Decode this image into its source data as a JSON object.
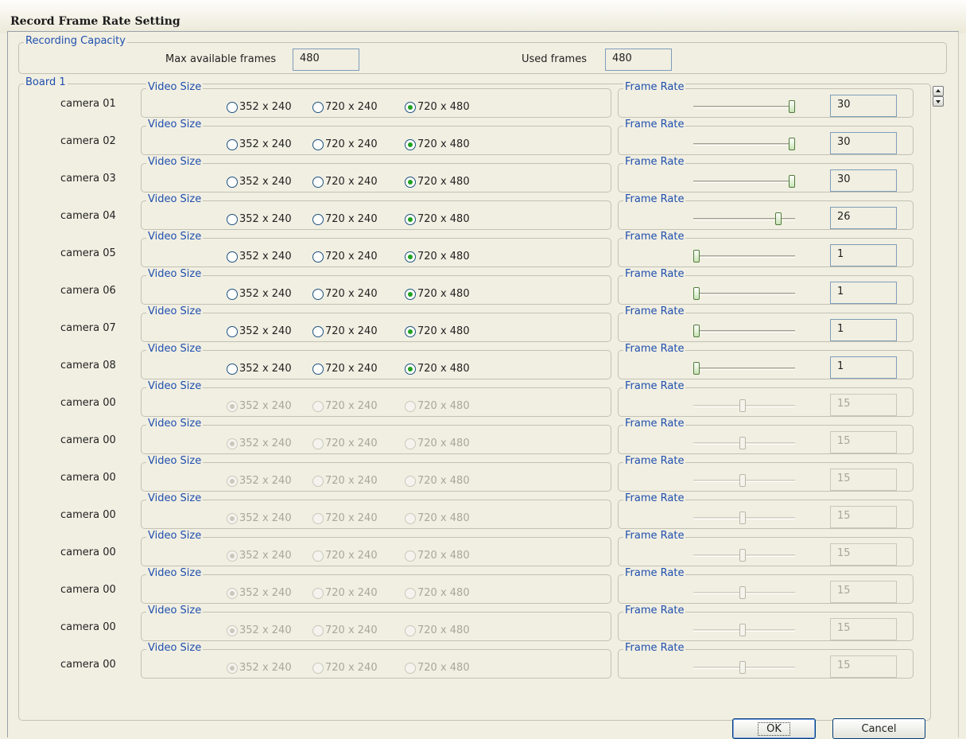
{
  "window": {
    "title": "Record Frame Rate Setting"
  },
  "capacity": {
    "legend": "Recording Capacity",
    "max_label": "Max available frames",
    "max_value": "480",
    "used_label": "Used frames",
    "used_value": "480"
  },
  "board": {
    "legend": "Board 1",
    "video_size_legend": "Video Size",
    "frame_rate_legend": "Frame Rate",
    "size_options": [
      "352 x 240",
      "720 x 240",
      "720 x 480"
    ],
    "frame_rate_range": [
      1,
      30
    ],
    "cameras": [
      {
        "name": "camera 01",
        "selected_size": "720 x 480",
        "frame_rate": "30",
        "enabled": true
      },
      {
        "name": "camera 02",
        "selected_size": "720 x 480",
        "frame_rate": "30",
        "enabled": true
      },
      {
        "name": "camera 03",
        "selected_size": "720 x 480",
        "frame_rate": "30",
        "enabled": true
      },
      {
        "name": "camera 04",
        "selected_size": "720 x 480",
        "frame_rate": "26",
        "enabled": true
      },
      {
        "name": "camera 05",
        "selected_size": "720 x 480",
        "frame_rate": "1",
        "enabled": true
      },
      {
        "name": "camera 06",
        "selected_size": "720 x 480",
        "frame_rate": "1",
        "enabled": true
      },
      {
        "name": "camera 07",
        "selected_size": "720 x 480",
        "frame_rate": "1",
        "enabled": true
      },
      {
        "name": "camera 08",
        "selected_size": "720 x 480",
        "frame_rate": "1",
        "enabled": true
      },
      {
        "name": "camera 00",
        "selected_size": "352 x 240",
        "frame_rate": "15",
        "enabled": false
      },
      {
        "name": "camera 00",
        "selected_size": "352 x 240",
        "frame_rate": "15",
        "enabled": false
      },
      {
        "name": "camera 00",
        "selected_size": "352 x 240",
        "frame_rate": "15",
        "enabled": false
      },
      {
        "name": "camera 00",
        "selected_size": "352 x 240",
        "frame_rate": "15",
        "enabled": false
      },
      {
        "name": "camera 00",
        "selected_size": "352 x 240",
        "frame_rate": "15",
        "enabled": false
      },
      {
        "name": "camera 00",
        "selected_size": "352 x 240",
        "frame_rate": "15",
        "enabled": false
      },
      {
        "name": "camera 00",
        "selected_size": "352 x 240",
        "frame_rate": "15",
        "enabled": false
      },
      {
        "name": "camera 00",
        "selected_size": "352 x 240",
        "frame_rate": "15",
        "enabled": false
      }
    ]
  },
  "buttons": {
    "ok": "OK",
    "cancel": "Cancel"
  },
  "icons": {
    "scroll_up": "scroll-up-arrow-icon",
    "scroll_down": "scroll-down-arrow-icon"
  },
  "colors": {
    "legend_text": "#1f4fae",
    "slider_thumb": "#c8e3b6",
    "radio_selected": "#21a121",
    "dialog_bg": "#f1efe2"
  }
}
